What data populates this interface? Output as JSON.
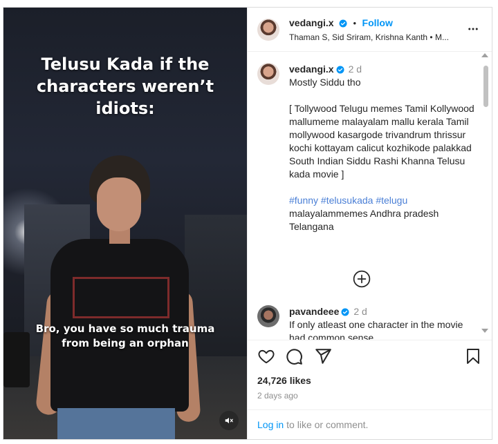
{
  "video": {
    "overlay_title": "Telusu Kada if the characters weren’t idiots:",
    "overlay_caption": "Bro, you have so much trauma from being an orphan",
    "mute_icon": "speaker-muted-icon"
  },
  "header": {
    "username": "vedangi.x",
    "verified_icon": "verified-badge-icon",
    "separator": "•",
    "follow_label": "Follow",
    "audio": "Thaman S, Sid Sriram, Krishna Kanth • M...",
    "more_icon": "more-options-icon"
  },
  "caption": {
    "username": "vedangi.x",
    "time": "2 d",
    "line1": "Mostly Siddu tho",
    "text": "[ Tollywood Telugu memes Tamil Kollywood mallumeme malayalam mallu kerala Tamil mollywood kasargode trivandrum thrissur kochi kottayam calicut kozhikode palakkad South Indian Siddu Rashi Khanna Telusu kada movie ]",
    "hashtags": "#funny #telusukada #telugu",
    "tags_rest": "malayalammemes Andhra pradesh Telangana"
  },
  "load_more_icon": "plus-circle-icon",
  "comment": {
    "username": "pavandeee",
    "time": "2 d",
    "text": "If only atleast one character in the movie had common sense"
  },
  "actions": {
    "like_icon": "heart-icon",
    "comment_icon": "comment-icon",
    "share_icon": "share-icon",
    "save_icon": "bookmark-icon"
  },
  "likes": "24,726 likes",
  "date": "2 days ago",
  "footer": {
    "login_label": "Log in",
    "rest": "to like or comment."
  },
  "colors": {
    "link_blue": "#0095f6",
    "hashtag_blue": "#4a7fd6",
    "muted_text": "#8e8e8e"
  }
}
